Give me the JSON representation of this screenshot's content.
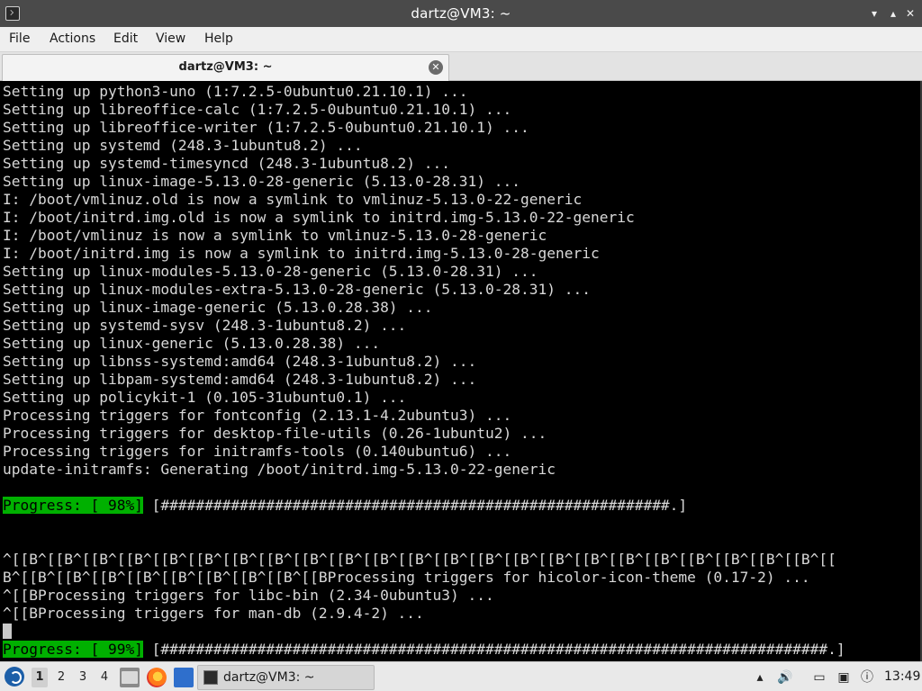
{
  "window": {
    "title": "dartz@VM3: ~",
    "minimize_glyph": "▾",
    "maximize_glyph": "▴",
    "close_glyph": "✕"
  },
  "menu": [
    "File",
    "Actions",
    "Edit",
    "View",
    "Help"
  ],
  "tab": {
    "label": "dartz@VM3: ~",
    "close_glyph": "✕"
  },
  "terminal": {
    "lines": [
      "Setting up python3-uno (1:7.2.5-0ubuntu0.21.10.1) ...",
      "Setting up libreoffice-calc (1:7.2.5-0ubuntu0.21.10.1) ...",
      "Setting up libreoffice-writer (1:7.2.5-0ubuntu0.21.10.1) ...",
      "Setting up systemd (248.3-1ubuntu8.2) ...",
      "Setting up systemd-timesyncd (248.3-1ubuntu8.2) ...",
      "Setting up linux-image-5.13.0-28-generic (5.13.0-28.31) ...",
      "I: /boot/vmlinuz.old is now a symlink to vmlinuz-5.13.0-22-generic",
      "I: /boot/initrd.img.old is now a symlink to initrd.img-5.13.0-22-generic",
      "I: /boot/vmlinuz is now a symlink to vmlinuz-5.13.0-28-generic",
      "I: /boot/initrd.img is now a symlink to initrd.img-5.13.0-28-generic",
      "Setting up linux-modules-5.13.0-28-generic (5.13.0-28.31) ...",
      "Setting up linux-modules-extra-5.13.0-28-generic (5.13.0-28.31) ...",
      "Setting up linux-image-generic (5.13.0.28.38) ...",
      "Setting up systemd-sysv (248.3-1ubuntu8.2) ...",
      "Setting up linux-generic (5.13.0.28.38) ...",
      "Setting up libnss-systemd:amd64 (248.3-1ubuntu8.2) ...",
      "Setting up libpam-systemd:amd64 (248.3-1ubuntu8.2) ...",
      "Setting up policykit-1 (0.105-31ubuntu0.1) ...",
      "Processing triggers for fontconfig (2.13.1-4.2ubuntu3) ...",
      "Processing triggers for desktop-file-utils (0.26-1ubuntu2) ...",
      "Processing triggers for initramfs-tools (0.140ubuntu6) ...",
      "update-initramfs: Generating /boot/initrd.img-5.13.0-22-generic",
      "",
      "",
      "",
      "",
      "^[[B^[[B^[[B^[[B^[[B^[[B^[[B^[[B^[[B^[[B^[[B^[[B^[[B^[[B^[[B^[[B^[[B^[[B^[[B^[[B^[[B^[[B^[[B^[[",
      "B^[[B^[[B^[[B^[[B^[[B^[[B^[[B^[[B^[[BProcessing triggers for hicolor-icon-theme (0.17-2) ...",
      "^[[BProcessing triggers for libc-bin (2.34-0ubuntu3) ...",
      "^[[BProcessing triggers for man-db (2.9.4-2) ..."
    ],
    "progress_98": {
      "label": "Progress: [ 98%]",
      "bar": " [##########################################################.]"
    },
    "progress_99": {
      "label": "Progress: [ 99%]",
      "bar": " [############################################################################.]"
    }
  },
  "taskbar": {
    "workspaces": [
      "1",
      "2",
      "3",
      "4"
    ],
    "active_workspace": "1",
    "task_label": "dartz@VM3: ~",
    "clock": "13:49",
    "volume_glyph": "🔊",
    "tray_glyphs": [
      "▴",
      "▭",
      "▣",
      "ⓘ"
    ]
  },
  "colors": {
    "progress_bg": "#00b000",
    "terminal_bg": "#000000",
    "terminal_fg": "#d8d8d8",
    "titlebar_bg": "#4a4a4a"
  }
}
